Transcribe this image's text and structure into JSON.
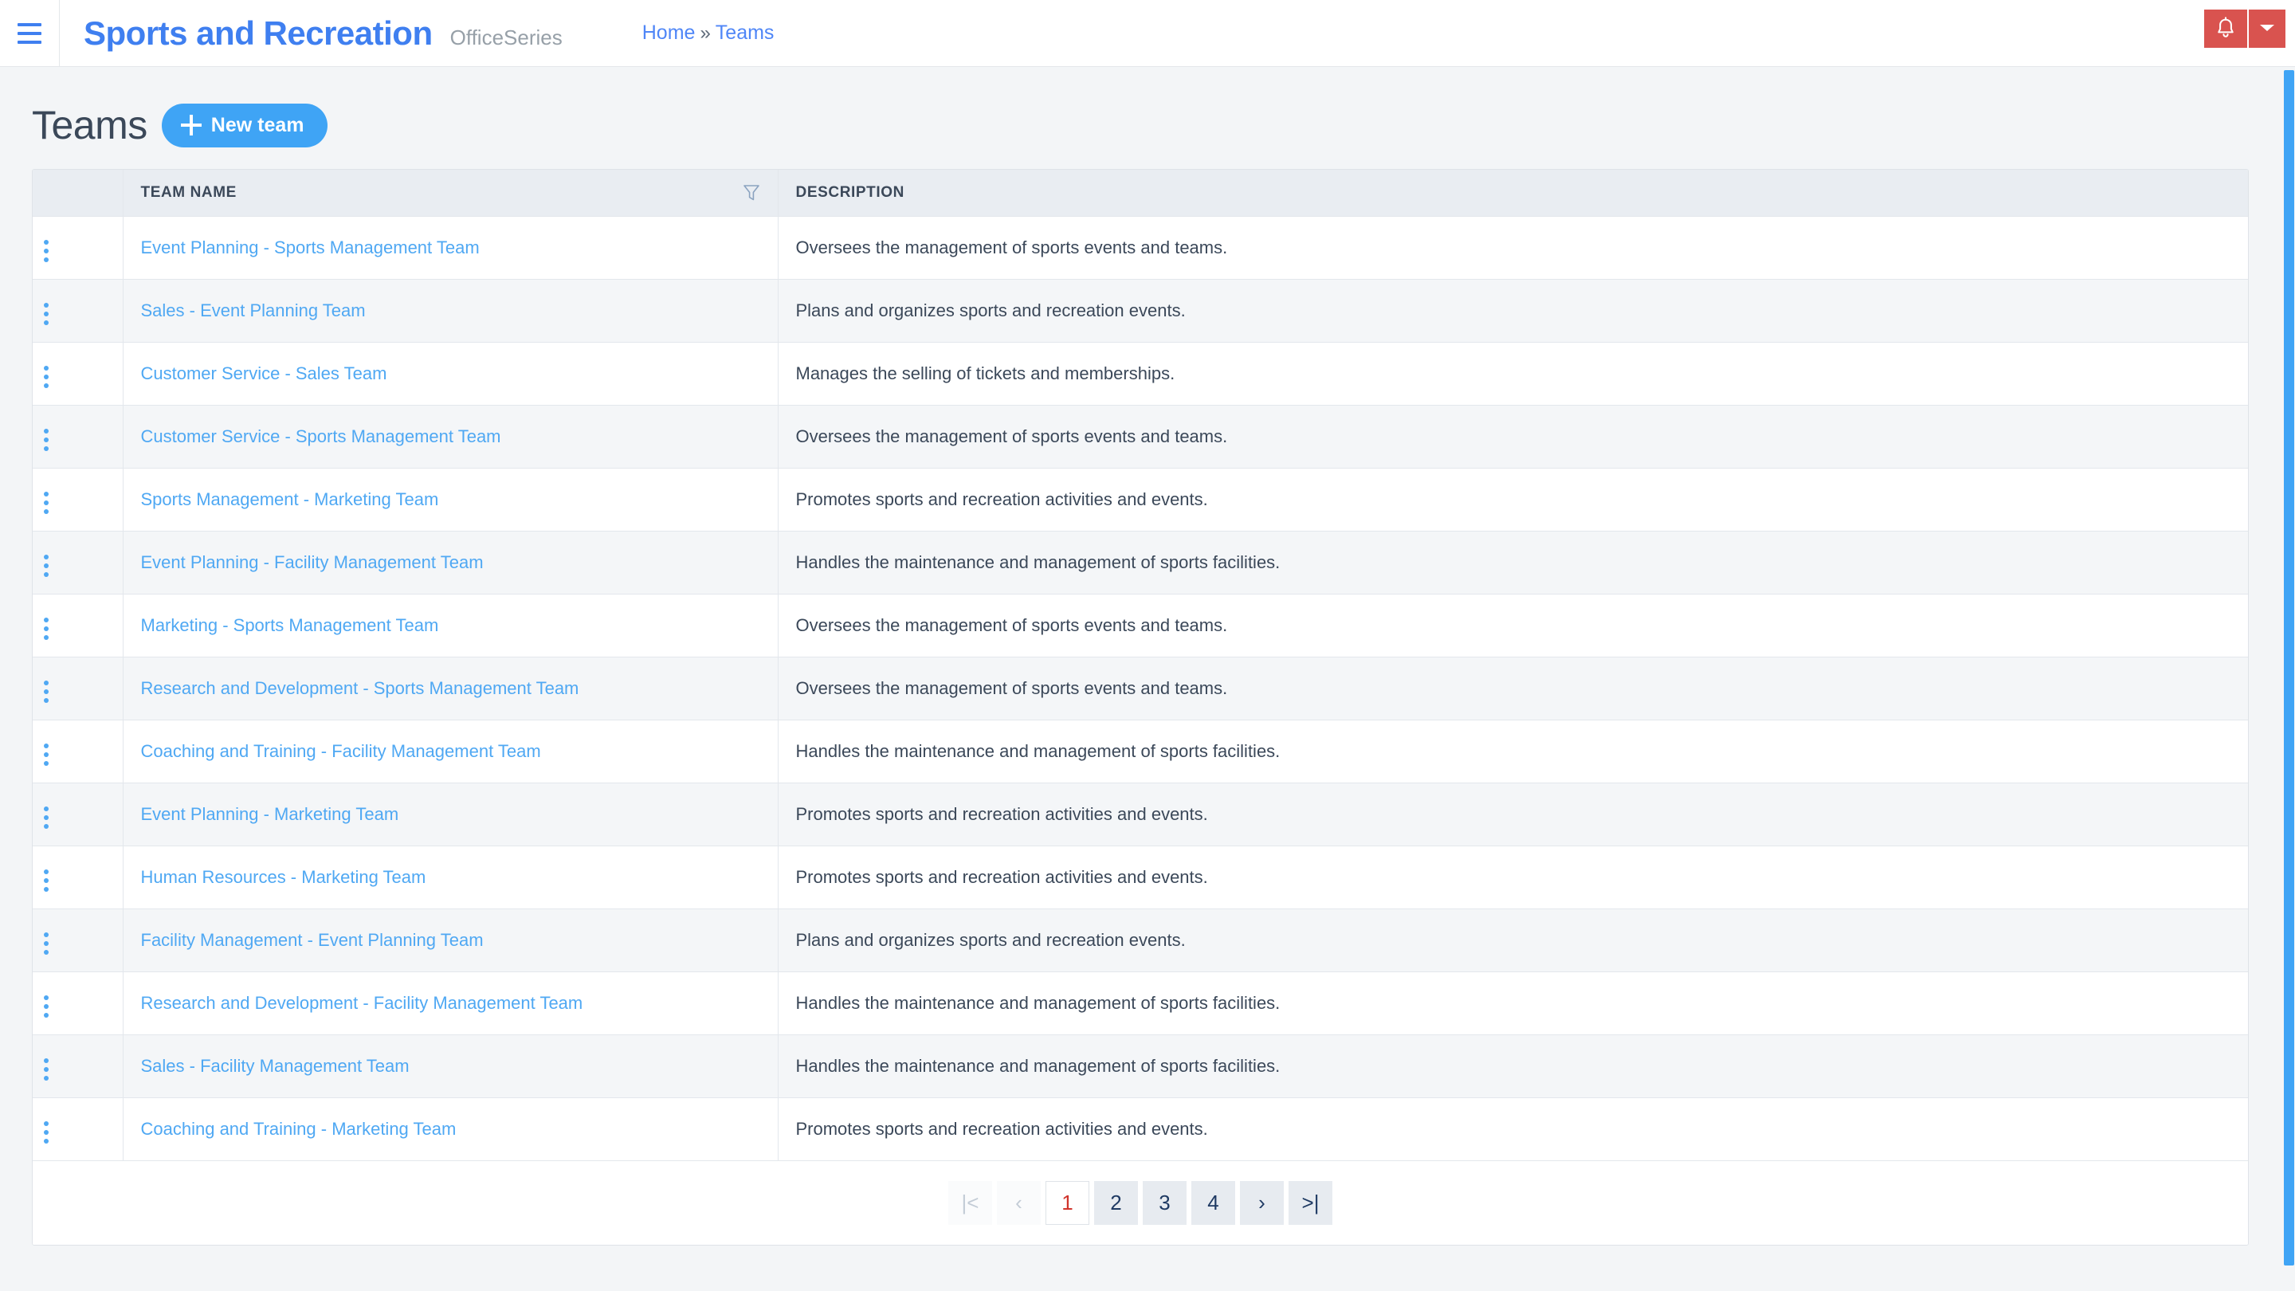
{
  "topbar": {
    "menu_icon": "hamburger-icon",
    "brand_title": "Sports and Recreation",
    "brand_subtitle": "OfficeSeries",
    "breadcrumb": {
      "home": "Home",
      "separator": "»",
      "current": "Teams"
    },
    "notification_icon": "bell-icon",
    "caret_icon": "chevron-down-icon",
    "accent_red": "#d9534f",
    "accent_blue": "#3f7ff0"
  },
  "page": {
    "title": "Teams",
    "new_button_label": "New team",
    "new_button_color": "#3fa4f5"
  },
  "table": {
    "columns": {
      "menu": "",
      "name": "TEAM NAME",
      "description": "DESCRIPTION"
    },
    "filter_icon": "filter-funnel-icon",
    "row_menu_icon": "kebab-menu-icon",
    "rows": [
      {
        "name": "Event Planning - Sports Management Team",
        "description": "Oversees the management of sports events and teams."
      },
      {
        "name": "Sales - Event Planning Team",
        "description": "Plans and organizes sports and recreation events."
      },
      {
        "name": "Customer Service - Sales Team",
        "description": "Manages the selling of tickets and memberships."
      },
      {
        "name": "Customer Service - Sports Management Team",
        "description": "Oversees the management of sports events and teams."
      },
      {
        "name": "Sports Management - Marketing Team",
        "description": "Promotes sports and recreation activities and events."
      },
      {
        "name": "Event Planning - Facility Management Team",
        "description": "Handles the maintenance and management of sports facilities."
      },
      {
        "name": "Marketing - Sports Management Team",
        "description": "Oversees the management of sports events and teams."
      },
      {
        "name": "Research and Development - Sports Management Team",
        "description": "Oversees the management of sports events and teams."
      },
      {
        "name": "Coaching and Training - Facility Management Team",
        "description": "Handles the maintenance and management of sports facilities."
      },
      {
        "name": "Event Planning - Marketing Team",
        "description": "Promotes sports and recreation activities and events."
      },
      {
        "name": "Human Resources - Marketing Team",
        "description": "Promotes sports and recreation activities and events."
      },
      {
        "name": "Facility Management - Event Planning Team",
        "description": "Plans and organizes sports and recreation events."
      },
      {
        "name": "Research and Development - Facility Management Team",
        "description": "Handles the maintenance and management of sports facilities."
      },
      {
        "name": "Sales - Facility Management Team",
        "description": "Handles the maintenance and management of sports facilities."
      },
      {
        "name": "Coaching and Training - Marketing Team",
        "description": "Promotes sports and recreation activities and events."
      }
    ]
  },
  "pagination": {
    "first_label": "|<",
    "prev_label": "‹",
    "next_label": "›",
    "last_label": ">|",
    "pages": [
      "1",
      "2",
      "3",
      "4"
    ],
    "active_page": "1",
    "active_color": "#d0342c"
  }
}
